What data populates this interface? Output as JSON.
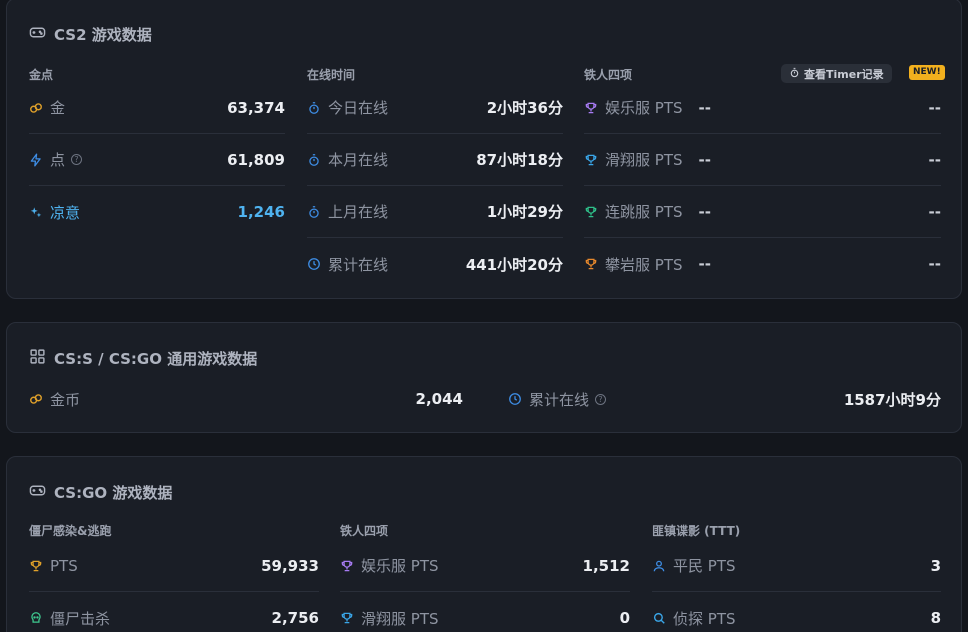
{
  "cs2": {
    "title": "CS2 游戏数据",
    "gold_header": "金点",
    "gold_rows": [
      {
        "label": "金",
        "value": "63,374"
      },
      {
        "label": "点",
        "value": "61,809"
      },
      {
        "label": "凉意",
        "value": "1,246"
      }
    ],
    "online_header": "在线时间",
    "online_rows": [
      {
        "label": "今日在线",
        "value": "2小时36分"
      },
      {
        "label": "本月在线",
        "value": "87小时18分"
      },
      {
        "label": "上月在线",
        "value": "1小时29分"
      },
      {
        "label": "累计在线",
        "value": "441小时20分"
      }
    ],
    "iron_header": "铁人四项",
    "timer_button": "查看Timer记录",
    "new_badge": "NEW!",
    "iron_rows": [
      {
        "label": "娱乐服 PTS",
        "dash": "--",
        "dash_right": "--",
        "color": "#a77bf3"
      },
      {
        "label": "滑翔服 PTS",
        "dash": "--",
        "dash_right": "--",
        "color": "#3aa6e8"
      },
      {
        "label": "连跳服 PTS",
        "dash": "--",
        "dash_right": "--",
        "color": "#2fc08a"
      },
      {
        "label": "攀岩服 PTS",
        "dash": "--",
        "dash_right": "--",
        "color": "#e8892c"
      }
    ]
  },
  "csgo_general": {
    "title": "CS:S / CS:GO 通用游戏数据",
    "coins_label": "金币",
    "coins_value": "2,044",
    "online_label": "累计在线",
    "online_value": "1587小时9分"
  },
  "csgo": {
    "title": "CS:GO 游戏数据",
    "zombie_header": "僵尸感染&逃跑",
    "zombie_rows": [
      {
        "label": "PTS",
        "value": "59,933"
      },
      {
        "label": "僵尸击杀",
        "value": "2,756"
      }
    ],
    "iron_header": "铁人四项",
    "iron_rows": [
      {
        "label": "娱乐服 PTS",
        "value": "1,512"
      },
      {
        "label": "滑翔服 PTS",
        "value": "0"
      }
    ],
    "ttt_header": "匪镇谍影 (TTT)",
    "ttt_rows": [
      {
        "label": "平民 PTS",
        "value": "3"
      },
      {
        "label": "侦探 PTS",
        "value": "8"
      }
    ]
  },
  "colors": {
    "gold": "#e0a12a",
    "blue": "#3e8ee6",
    "cool": "#4fb3f0",
    "green": "#3ec98f",
    "purple": "#a77bf3"
  }
}
